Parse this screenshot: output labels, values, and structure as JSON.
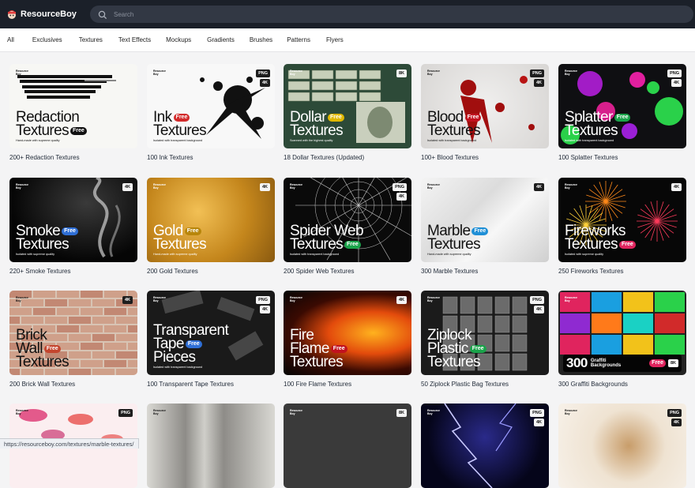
{
  "app": {
    "logo_text": "ResourceBoy",
    "search_placeholder": "Search",
    "status_url": "https://resourceboy.com/textures/marble-textures/"
  },
  "nav": {
    "items": [
      "All",
      "Exclusives",
      "Textures",
      "Text Effects",
      "Mockups",
      "Gradients",
      "Brushes",
      "Patterns",
      "Flyers"
    ]
  },
  "rb_tag": "Resource\nBoy",
  "cards": [
    {
      "caption": "200+ Redaction Textures",
      "lines": [
        "Redaction",
        "Textures"
      ],
      "free_line": 1,
      "subtitle": "Hand-made with supreme quality",
      "badges": [],
      "theme": "light",
      "bg": "redaction",
      "free_color": "#111111"
    },
    {
      "caption": "100 Ink Textures",
      "lines": [
        "Ink",
        "Textures"
      ],
      "free_line": 0,
      "subtitle": "Isolated with transparent background",
      "badges": [
        "PNG",
        "4K"
      ],
      "theme": "light",
      "bg": "ink",
      "free_color": "#d22a2a"
    },
    {
      "caption": "18 Dollar Textures (Updated)",
      "lines": [
        "Dollar",
        "Textures"
      ],
      "free_line": 0,
      "subtitle": "Scanned with the highest quality",
      "badges": [
        "8K"
      ],
      "theme": "dark",
      "bg": "dollar",
      "free_color": "#e0b800"
    },
    {
      "caption": "100+ Blood Textures",
      "lines": [
        "Blood",
        "Textures"
      ],
      "free_line": 0,
      "subtitle": "Isolated with transparent background",
      "badges": [
        "PNG",
        "4K"
      ],
      "theme": "light",
      "bg": "blood",
      "free_color": "#c1121f"
    },
    {
      "caption": "100 Splatter Textures",
      "lines": [
        "Splatter",
        "Textures"
      ],
      "free_line": 0,
      "subtitle": "Isolated with transparent background",
      "badges": [
        "PNG",
        "4K"
      ],
      "theme": "dark",
      "bg": "splatter",
      "free_color": "#1aa34a"
    },
    {
      "caption": "220+ Smoke Textures",
      "lines": [
        "Smoke",
        "Textures"
      ],
      "free_line": 0,
      "subtitle": "Isolated with supreme quality",
      "badges": [
        "4K"
      ],
      "theme": "dark",
      "bg": "smoke",
      "free_color": "#2f6fd6"
    },
    {
      "caption": "200 Gold Textures",
      "lines": [
        "Gold",
        "Textures"
      ],
      "free_line": 0,
      "subtitle": "Hand-made with supreme quality",
      "badges": [
        "4K"
      ],
      "theme": "dark",
      "bg": "gold",
      "free_color": "#b8860b"
    },
    {
      "caption": "200 Spider Web Textures",
      "lines": [
        "Spider Web",
        "Textures"
      ],
      "free_line": 1,
      "subtitle": "Isolated with transparent background",
      "badges": [
        "PNG",
        "4K"
      ],
      "theme": "dark",
      "bg": "spider",
      "free_color": "#1aa34a"
    },
    {
      "caption": "300 Marble Textures",
      "lines": [
        "Marble",
        "Textures"
      ],
      "free_line": 0,
      "subtitle": "Hand-made with supreme quality",
      "badges": [
        "4K"
      ],
      "theme": "light",
      "bg": "marble",
      "free_color": "#1f8fd6"
    },
    {
      "caption": "250 Fireworks Textures",
      "lines": [
        "Fireworks",
        "Textures"
      ],
      "free_line": 1,
      "subtitle": "Isolated with supreme quality",
      "badges": [
        "4K"
      ],
      "theme": "dark",
      "bg": "fireworks",
      "free_color": "#e0245e"
    },
    {
      "caption": "200 Brick Wall Textures",
      "lines": [
        "Brick",
        "Wall",
        "Textures"
      ],
      "free_line": 1,
      "subtitle": "",
      "badges": [
        "4K"
      ],
      "theme": "light",
      "bg": "brick",
      "free_color": "#c4452e"
    },
    {
      "caption": "100 Transparent Tape Textures",
      "lines": [
        "Transparent",
        "Tape",
        "Pieces"
      ],
      "free_line": 1,
      "subtitle": "Isolated with transparent background",
      "badges": [
        "PNG",
        "4K"
      ],
      "theme": "dark",
      "bg": "tape",
      "free_color": "#2f6fd6"
    },
    {
      "caption": "100 Fire Flame Textures",
      "lines": [
        "Fire",
        "Flame",
        "Textures"
      ],
      "free_line": 1,
      "subtitle": "",
      "badges": [
        "4K"
      ],
      "theme": "dark",
      "bg": "fire",
      "free_color": "#c1121f"
    },
    {
      "caption": "50 Ziplock Plastic Bag Textures",
      "lines": [
        "Ziplock",
        "Plastic",
        "Textures"
      ],
      "free_line": 1,
      "subtitle": "",
      "badges": [
        "PNG",
        "4K"
      ],
      "theme": "dark",
      "bg": "ziplock",
      "free_color": "#1aa34a"
    },
    {
      "caption": "300 Graffiti Backgrounds",
      "lines": [
        "300"
      ],
      "free_line": -1,
      "subtitle": "",
      "badges": [],
      "theme": "dark",
      "bg": "graffiti",
      "free_color": "#e0245e",
      "extra": {
        "small_text": "Graffiti\nBackgrounds",
        "free": "Free",
        "res": "8K"
      }
    },
    {
      "caption": "",
      "lines": [],
      "free_line": -1,
      "subtitle": "",
      "badges": [
        "PNG"
      ],
      "theme": "light",
      "bg": "lips",
      "free_color": "#c1121f"
    },
    {
      "caption": "",
      "lines": [],
      "free_line": -1,
      "subtitle": "",
      "badges": [],
      "theme": "light",
      "bg": "shadow",
      "free_color": "#111"
    },
    {
      "caption": "",
      "lines": [],
      "free_line": -1,
      "subtitle": "",
      "badges": [
        "8K"
      ],
      "theme": "dark",
      "bg": "concrete",
      "free_color": "#111"
    },
    {
      "caption": "",
      "lines": [],
      "free_line": -1,
      "subtitle": "",
      "badges": [
        "PNG",
        "4K"
      ],
      "theme": "dark",
      "bg": "lightning",
      "free_color": "#111"
    },
    {
      "caption": "",
      "lines": [],
      "free_line": -1,
      "subtitle": "",
      "badges": [
        "PNG",
        "4K"
      ],
      "theme": "light",
      "bg": "coffee",
      "free_color": "#111"
    }
  ],
  "free_label": "Free"
}
